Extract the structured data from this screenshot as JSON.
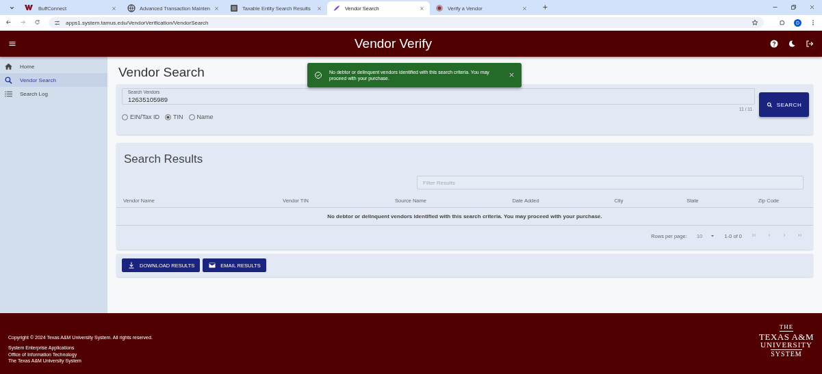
{
  "browser": {
    "tabs": [
      {
        "title": "BuffConnect",
        "selected": false
      },
      {
        "title": "Advanced Transaction Mainten",
        "selected": false
      },
      {
        "title": "Taxable Entity Search Results",
        "selected": false
      },
      {
        "title": "Vendor Search",
        "selected": true
      },
      {
        "title": "Verify a Vendor",
        "selected": false
      }
    ],
    "url": "apps1.system.tamus.edu/VendorVerification/VendorSearch",
    "profile": "D"
  },
  "app": {
    "title": "Vendor Verify"
  },
  "sidebar": {
    "items": [
      {
        "label": "Home",
        "selected": false
      },
      {
        "label": "Vendor Search",
        "selected": true
      },
      {
        "label": "Search Log",
        "selected": false
      }
    ]
  },
  "page_title": "Vendor Search",
  "toast": {
    "message": "No debtor or delinquent vendors identified with this search criteria. You may proceed with your purchase."
  },
  "search": {
    "label": "Search Vendors",
    "value": "12635105989",
    "counter": "11 / 11",
    "button": "SEARCH",
    "options": [
      {
        "label": "EIN/Tax ID",
        "selected": false
      },
      {
        "label": "TIN",
        "selected": true
      },
      {
        "label": "Name",
        "selected": false
      }
    ]
  },
  "results": {
    "title": "Search Results",
    "filter_placeholder": "Filter Results",
    "columns": [
      "Vendor Name",
      "Vendor TIN",
      "Source Name",
      "Date Added",
      "City",
      "State",
      "Zip Code"
    ],
    "empty_message": "No debtor or delinquent vendors identified with this search criteria. You may proceed with your purchase.",
    "rows_per_page_label": "Rows per page:",
    "rows_per_page": "10",
    "range": "1-0 of 0"
  },
  "actions": [
    {
      "label": "DOWNLOAD RESULTS"
    },
    {
      "label": "EMAIL RESULTS"
    }
  ],
  "footer": {
    "copyright": "Copyright © 2024 Texas A&M University System. All rights reserved.",
    "lines": [
      "System Enterprise Applications",
      "Office of Information Technology",
      "The Texas A&M University System"
    ],
    "logo": [
      "THE",
      "TEXAS A&M",
      "UNIVERSITY",
      "SYSTEM"
    ]
  }
}
